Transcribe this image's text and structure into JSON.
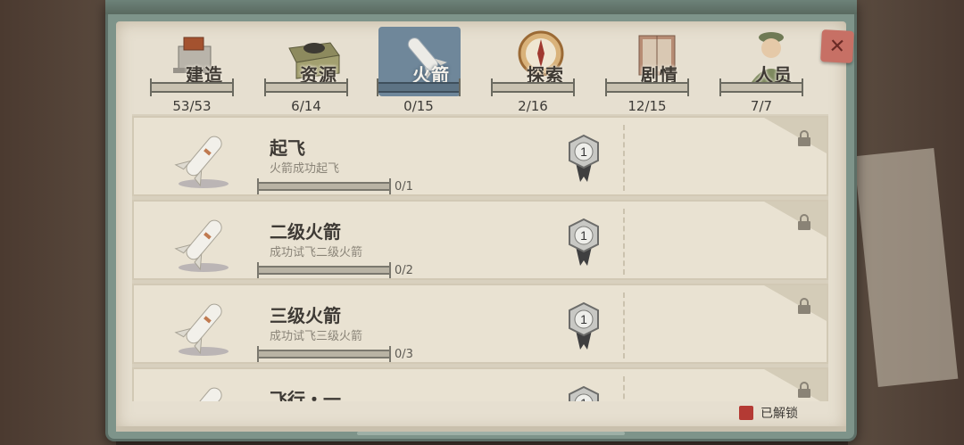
{
  "tabs": [
    {
      "label": "建造",
      "count": "53/53",
      "icon": "building-icon",
      "progress": 1.0
    },
    {
      "label": "资源",
      "count": "6/14",
      "icon": "resource-crate-icon",
      "progress": 0.43
    },
    {
      "label": "火箭",
      "count": "0/15",
      "icon": "rocket-icon",
      "progress": 0.0,
      "active": true
    },
    {
      "label": "探索",
      "count": "2/16",
      "icon": "compass-icon",
      "progress": 0.125
    },
    {
      "label": "剧情",
      "count": "12/15",
      "icon": "book-icon",
      "progress": 0.8
    },
    {
      "label": "人员",
      "count": "7/7",
      "icon": "officer-icon",
      "progress": 1.0
    }
  ],
  "achievements": [
    {
      "title": "起飞",
      "desc": "火箭成功起飞",
      "progress_text": "0/1",
      "medal": "1",
      "progress": 0.0
    },
    {
      "title": "二级火箭",
      "desc": "成功试飞二级火箭",
      "progress_text": "0/2",
      "medal": "1",
      "progress": 0.0
    },
    {
      "title": "三级火箭",
      "desc": "成功试飞三级火箭",
      "progress_text": "0/3",
      "medal": "1",
      "progress": 0.0
    },
    {
      "title": "飞行・一",
      "desc": "",
      "progress_text": "",
      "medal": "1",
      "progress": 0.0
    }
  ],
  "legend": {
    "label": "已解锁",
    "color": "#b43a34"
  },
  "colors": {
    "active_tab": "#6f879a",
    "paper": "#e6dfd0",
    "board": "#7e948a",
    "close": "#c77065"
  }
}
